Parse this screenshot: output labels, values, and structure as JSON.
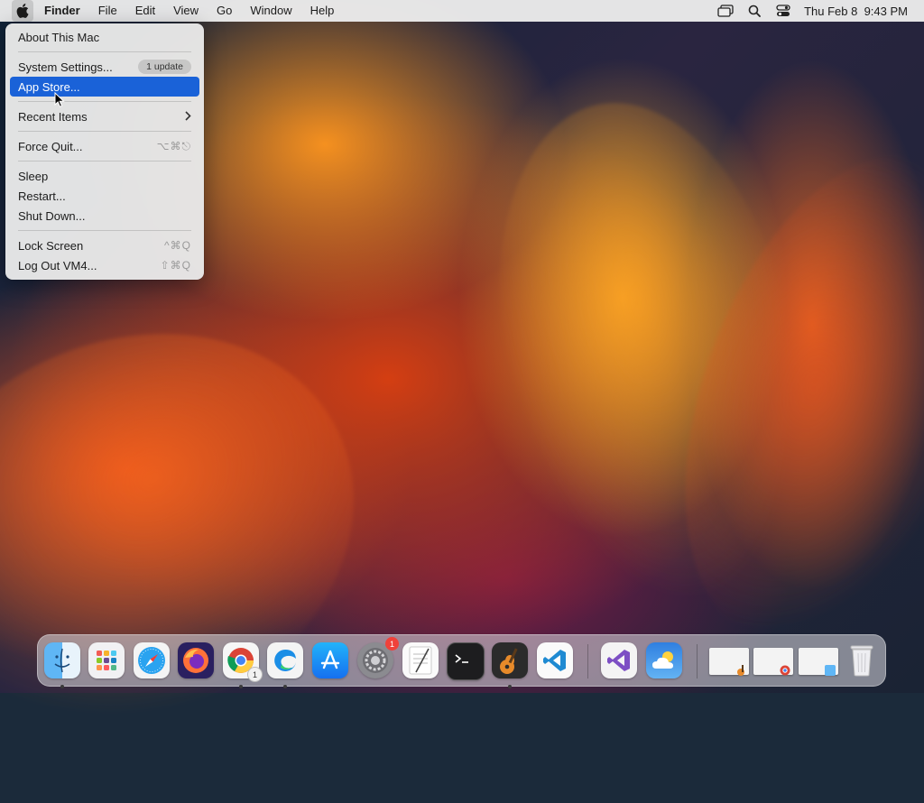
{
  "menubar": {
    "app_name": "Finder",
    "menus": [
      "File",
      "Edit",
      "View",
      "Go",
      "Window",
      "Help"
    ],
    "clock": "Thu Feb 8  9:43 PM"
  },
  "apple_menu": {
    "about": "About This Mac",
    "system_settings": "System Settings...",
    "update_badge": "1 update",
    "app_store": "App Store...",
    "recent_items": "Recent Items",
    "force_quit": "Force Quit...",
    "force_quit_shortcut": "⌥⌘⎋",
    "sleep": "Sleep",
    "restart": "Restart...",
    "shut_down": "Shut Down...",
    "lock_screen": "Lock Screen",
    "lock_shortcut": "^⌘Q",
    "log_out": "Log Out VM4...",
    "log_out_shortcut": "⇧⌘Q"
  },
  "dock": {
    "system_settings_badge": "1",
    "chrome_badge": "1"
  },
  "colors": {
    "selection": "#1a62d8",
    "badge_red": "#f0413a"
  }
}
